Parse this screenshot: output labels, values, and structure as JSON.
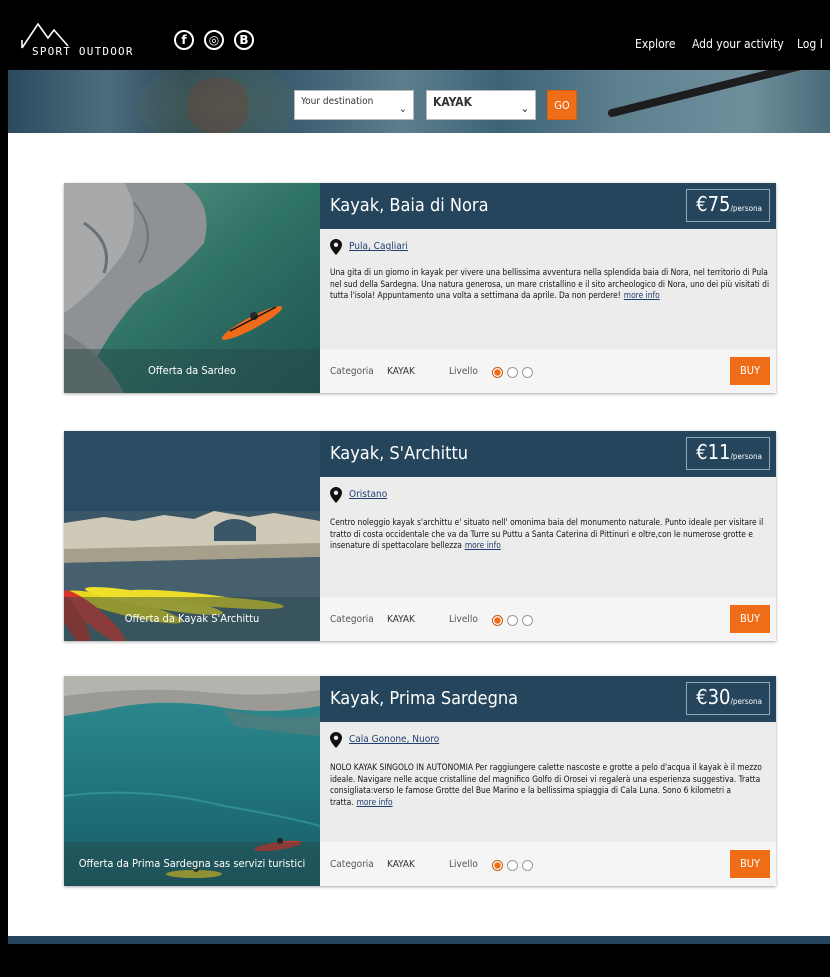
{
  "header": {
    "logo_text": "SPORT OUTDOOR",
    "social": [
      {
        "icon": "facebook-icon",
        "glyph": "f"
      },
      {
        "icon": "instagram-icon",
        "glyph": "◎"
      },
      {
        "icon": "blogger-icon",
        "glyph": "B"
      }
    ],
    "nav": {
      "explore": "Explore",
      "add_activity": "Add your activity",
      "login": "Log I"
    }
  },
  "search": {
    "destination_placeholder": "Your destination",
    "activity_value": "KAYAK",
    "go_label": "GO"
  },
  "colors": {
    "accent": "#f06d18",
    "header_bar": "#24455b"
  },
  "cards": [
    {
      "title": "Kayak, Baia di Nora",
      "price": "€75",
      "price_unit": "/persona",
      "location": "Pula, Cagliari",
      "description": "Una gita di un giorno in kayak per vivere una bellissima avventura nella splendida baia di Nora, nel territorio di Pula nel sud della Sardegna. Una natura generosa, un mare cristallino e il sito archeologico di Nora, uno dei più visitati di tutta l'isola! Appuntamento una volta a settimana da aprile. Da non perdere!",
      "more": "more info",
      "offer": "Offerta da Sardeo",
      "category_label": "Categoria",
      "category": "KAYAK",
      "level_label": "Livello",
      "level": 1,
      "buy": "BUY"
    },
    {
      "title": "Kayak, S'Archittu",
      "price": "€11",
      "price_unit": "/persona",
      "location": "Oristano",
      "description": "Centro noleggio kayak s'archittu e' situato nell' omonima baia del monumento naturale. Punto ideale per visitare il tratto di costa occidentale che va da Turre su Puttu a Santa Caterina di Pittinuri e oltre,con le numerose grotte e insenature di spettacolare bellezza",
      "more": "more info",
      "offer": "Offerta da Kayak S'Archittu",
      "category_label": "Categoria",
      "category": "KAYAK",
      "level_label": "Livello",
      "level": 1,
      "buy": "BUY"
    },
    {
      "title": "Kayak, Prima Sardegna",
      "price": "€30",
      "price_unit": "/persona",
      "location": "Cala Gonone, Nuoro",
      "description": "NOLO KAYAK SINGOLO IN AUTONOMIA Per raggiungere calette nascoste e grotte a pelo d'acqua il kayak è il mezzo ideale. Navigare nelle acque cristalline del magnifico Golfo di Orosei vi regalerà una esperienza suggestiva. Tratta consigliata:verso le famose Grotte del Bue Marino e la bellissima spiaggia di Cala Luna. Sono 6 kilometri a tratta.",
      "more": "more info",
      "offer": "Offerta da Prima Sardegna sas servizi turistici",
      "category_label": "Categoria",
      "category": "KAYAK",
      "level_label": "Livello",
      "level": 1,
      "buy": "BUY"
    }
  ]
}
